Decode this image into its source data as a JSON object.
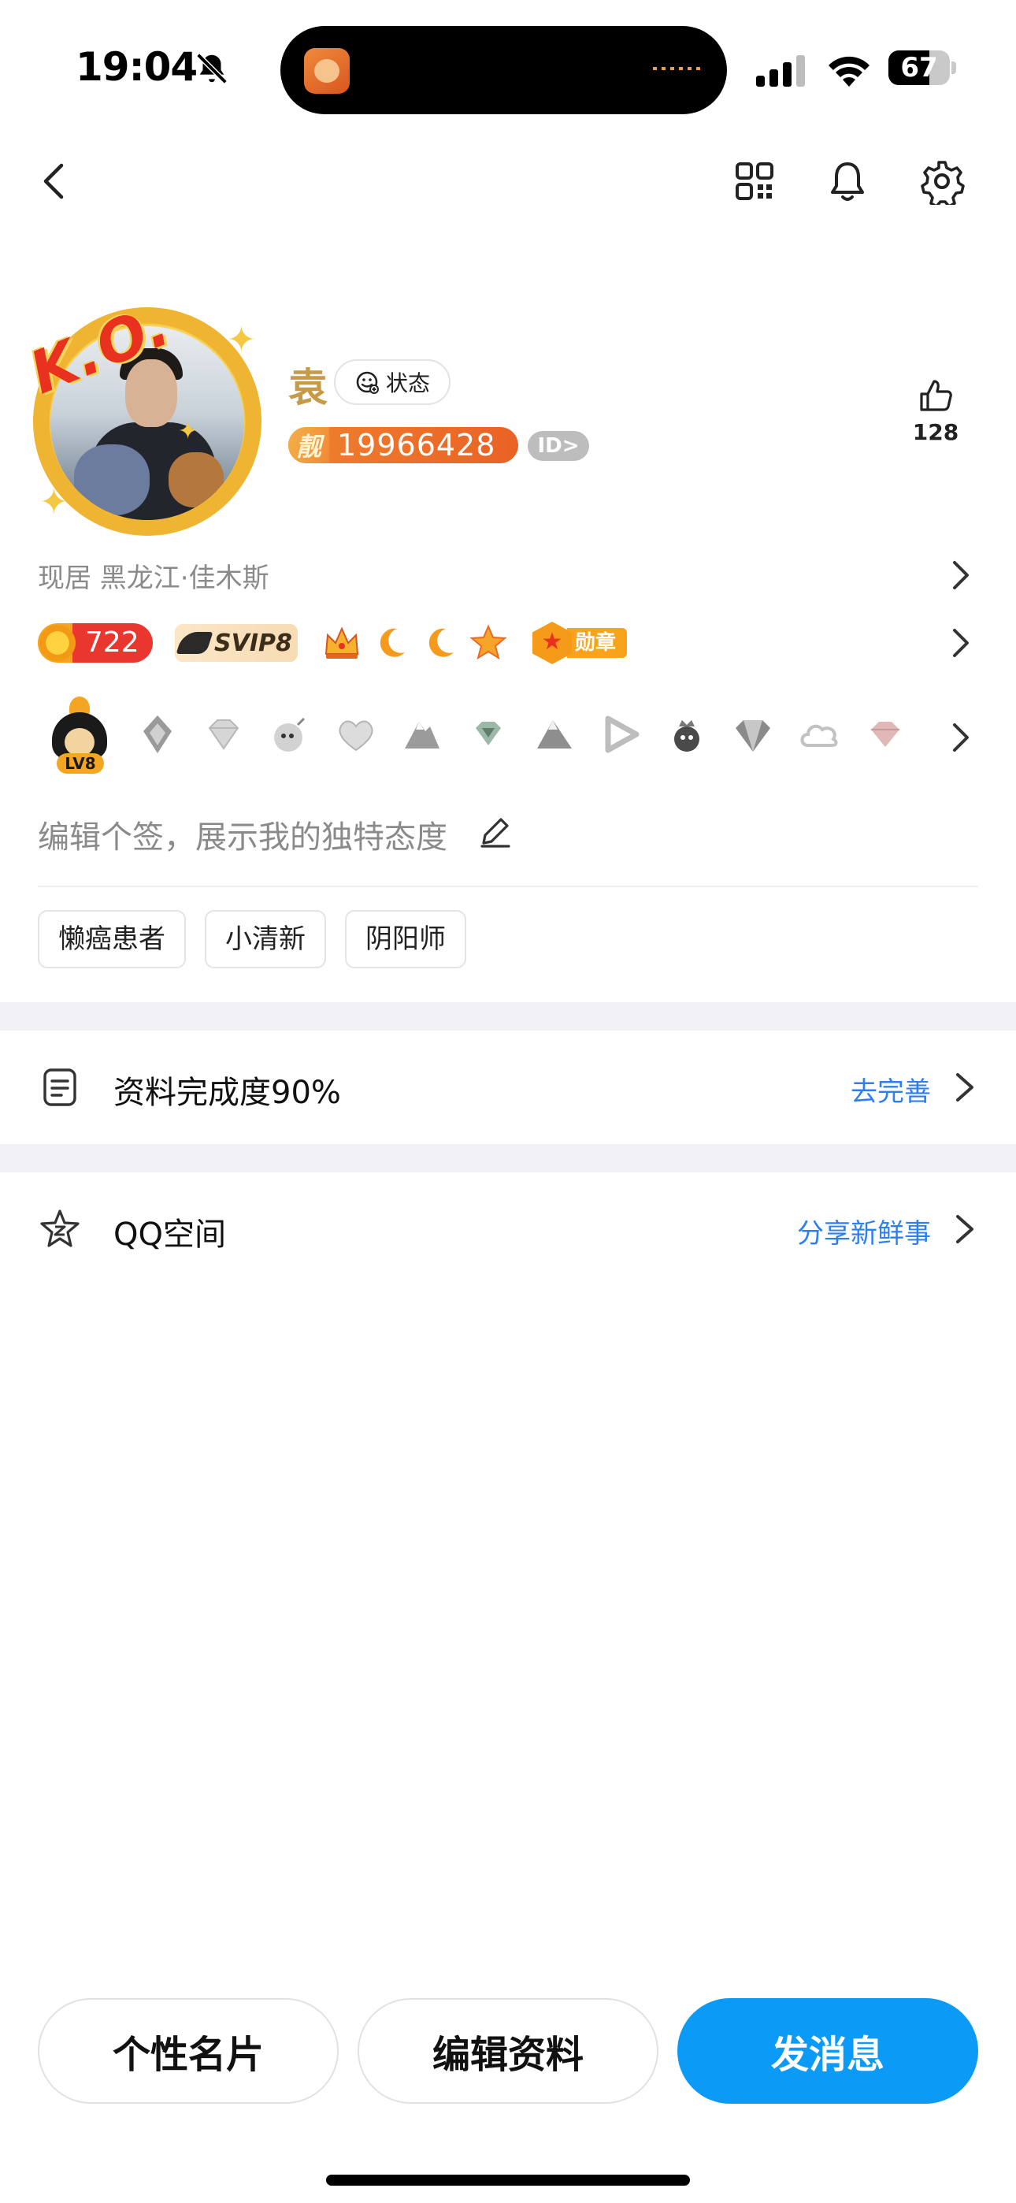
{
  "status_bar": {
    "time": "19:04",
    "battery_percent": 67
  },
  "nav": {
    "back_icon": "chevron-left-icon",
    "qr_icon": "qr-code-icon",
    "notification_icon": "bell-icon",
    "settings_icon": "gear-icon"
  },
  "profile": {
    "avatar_caption": "K.O.",
    "name": "袁",
    "status_label": "状态",
    "liang_label": "靓",
    "qq_number": "19966428",
    "id_label": "ID>",
    "likes": "128"
  },
  "location": "现居 黑龙江·佳木斯",
  "levels": {
    "coin_value": "722",
    "svip_label": "SVIP8",
    "medal_label": "勋章"
  },
  "badges": {
    "penguin_level": "LV8"
  },
  "signature_placeholder": "编辑个签，展示我的独特态度",
  "tags": [
    "懒癌患者",
    "小清新",
    "阴阳师"
  ],
  "rows": [
    {
      "title": "资料完成度90%",
      "action": "去完善",
      "icon": "document-icon"
    },
    {
      "title": "QQ空间",
      "action": "分享新鲜事",
      "icon": "qzone-star-icon"
    }
  ],
  "buttons": {
    "card": "个性名片",
    "edit": "编辑资料",
    "message": "发消息"
  },
  "colors": {
    "accent_blue": "#0b9af5",
    "link_blue": "#2d7ff0",
    "name_gold": "#c79a48",
    "qq_badge_orange": "#e96226"
  }
}
